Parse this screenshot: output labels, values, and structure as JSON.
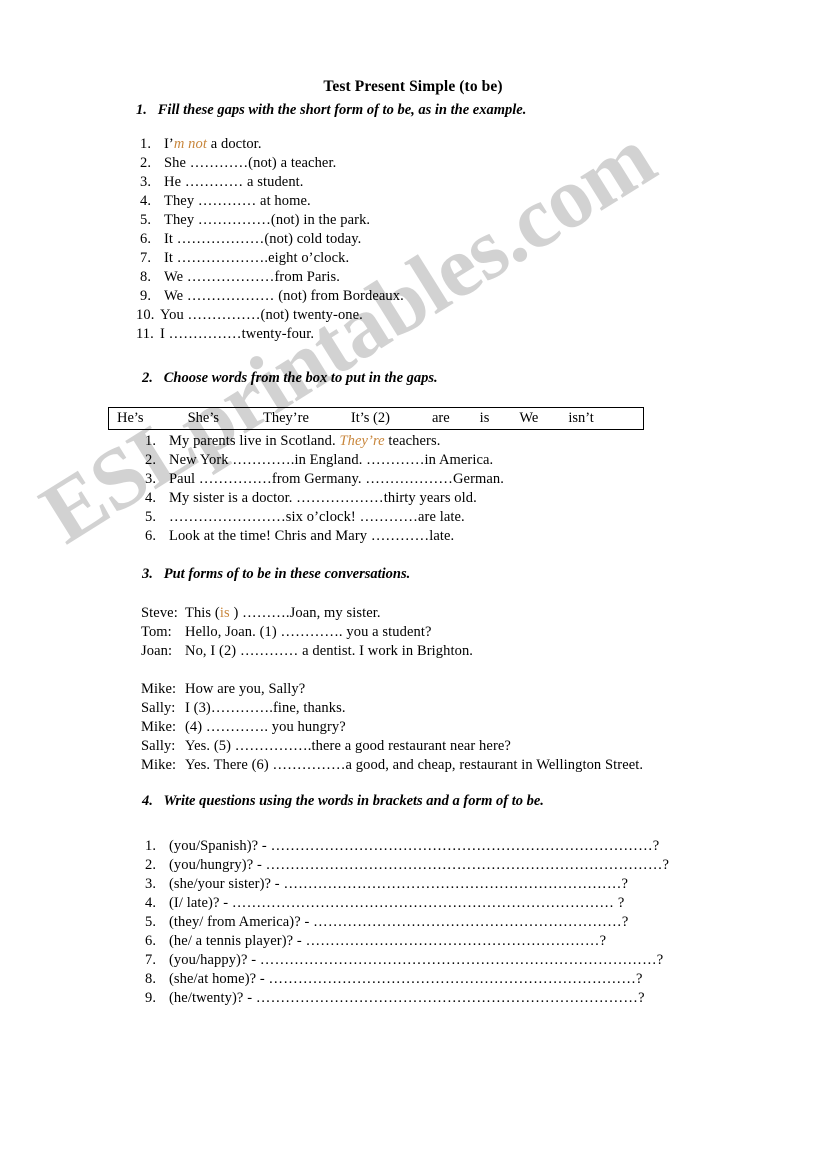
{
  "document": {
    "title": "Test Present Simple (to be)",
    "watermark": "ESLprintables.com",
    "accent_color": "#c8863c",
    "ink_color": "#000000",
    "background_color": "#ffffff"
  },
  "exercise1": {
    "number": "1.",
    "heading": "Fill these gaps with the short form of to be, as in the example.",
    "items": [
      {
        "num": "1.",
        "pre": "I’",
        "answer": "m not",
        "post": " a doctor."
      },
      {
        "num": "2.",
        "pre": "She …………(not) a teacher.",
        "answer": "",
        "post": ""
      },
      {
        "num": "3.",
        "pre": "He ………… a student.",
        "answer": "",
        "post": ""
      },
      {
        "num": "4.",
        "pre": "They ………… at home.",
        "answer": "",
        "post": ""
      },
      {
        "num": "5.",
        "pre": "They ……………(not) in the park.",
        "answer": "",
        "post": ""
      },
      {
        "num": "6.",
        "pre": "It ………………(not) cold today.",
        "answer": "",
        "post": ""
      },
      {
        "num": "7.",
        "pre": "It ……………….eight o’clock.",
        "answer": "",
        "post": ""
      },
      {
        "num": "8.",
        "pre": "We ………………from Paris.",
        "answer": "",
        "post": ""
      },
      {
        "num": "9.",
        "pre": "We ……………… (not) from Bordeaux.",
        "answer": "",
        "post": ""
      },
      {
        "num": "10.",
        "pre": "You ……………(not) twenty-one.",
        "answer": "",
        "post": ""
      },
      {
        "num": "11.",
        "pre": "I ……………twenty-four.",
        "answer": "",
        "post": ""
      }
    ]
  },
  "exercise2": {
    "number": "2.",
    "heading": "Choose words from the box to put in the gaps.",
    "word_box": [
      "He’s",
      "She’s",
      "They’re",
      "It’s (2)",
      "are",
      "is",
      "We",
      "isn’t"
    ],
    "items": [
      {
        "num": "1.",
        "pre": "My parents live in Scotland. ",
        "answer": "They’re",
        "post": " teachers."
      },
      {
        "num": "2.",
        "pre": "New York ………….in England. …………in America.",
        "answer": "",
        "post": ""
      },
      {
        "num": "3.",
        "pre": "Paul ……………from Germany. ………………German.",
        "answer": "",
        "post": ""
      },
      {
        "num": "4.",
        "pre": "My sister is a doctor. ………………thirty years old.",
        "answer": "",
        "post": ""
      },
      {
        "num": "5.",
        "pre": "……………………six o’clock! …………are late.",
        "answer": "",
        "post": ""
      },
      {
        "num": "6.",
        "pre": "Look at the time! Chris and Mary …………late.",
        "answer": "",
        "post": ""
      }
    ]
  },
  "exercise3": {
    "number": "3.",
    "heading": "Put forms of to be in these conversations.",
    "conversation1": [
      {
        "speaker": "Steve:",
        "pre": "This (",
        "answer": "is",
        "post": " ) ……….Joan, my sister."
      },
      {
        "speaker": "Tom:",
        "pre": "Hello, Joan. (1) …………. you a student?",
        "answer": "",
        "post": ""
      },
      {
        "speaker": "Joan:",
        "pre": "No, I (2) ………… a dentist. I work in Brighton.",
        "answer": "",
        "post": ""
      }
    ],
    "conversation2": [
      {
        "speaker": "Mike:",
        "pre": "How are you, Sally?",
        "answer": "",
        "post": ""
      },
      {
        "speaker": "Sally:",
        "pre": "I (3)………….fine, thanks.",
        "answer": "",
        "post": ""
      },
      {
        "speaker": "Mike:",
        "pre": "(4) …………. you hungry?",
        "answer": "",
        "post": ""
      },
      {
        "speaker": "Sally:",
        "pre": "Yes. (5) …………….there a good restaurant near here?",
        "answer": "",
        "post": ""
      },
      {
        "speaker": "Mike:",
        "pre": "Yes. There (6) ……………a good, and cheap, restaurant in Wellington Street.",
        "answer": "",
        "post": ""
      }
    ]
  },
  "exercise4": {
    "number": "4.",
    "heading": "Write questions using the words in brackets and a form of to be.",
    "items": [
      {
        "num": "1.",
        "prompt": "(you/Spanish)? -",
        "dots": "……………………………………………………………………?"
      },
      {
        "num": "2.",
        "prompt": "(you/hungry)? -",
        "dots": "………………………………………………………………………?"
      },
      {
        "num": "3.",
        "prompt": "(she/your sister)? -",
        "dots": "……………………………………………………………?"
      },
      {
        "num": "4.",
        "prompt": "(I/ late)? -",
        "dots": "…………………………………………………………………… ?"
      },
      {
        "num": "5.",
        "prompt": "(they/ from America)? -",
        "dots": "………………………………………………………?"
      },
      {
        "num": "6.",
        "prompt": "(he/ a tennis player)? -",
        "dots": "……………………………………………………?"
      },
      {
        "num": "7.",
        "prompt": "(you/happy)? -",
        "dots": "………………………………………………………………………?"
      },
      {
        "num": "8.",
        "prompt": "(she/at home)? -",
        "dots": "…………………………………………………………………?"
      },
      {
        "num": "9.",
        "prompt": "(he/twenty)? -",
        "dots": "……………………………………………………………………?"
      }
    ]
  }
}
